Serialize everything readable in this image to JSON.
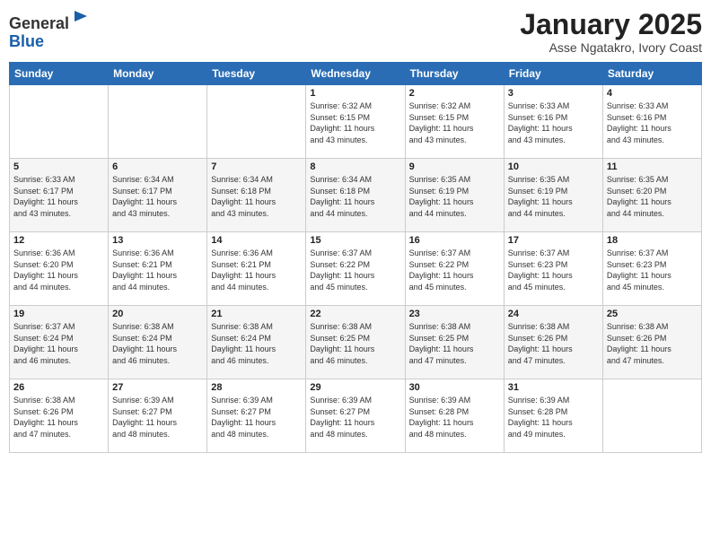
{
  "header": {
    "logo_general": "General",
    "logo_blue": "Blue",
    "month": "January 2025",
    "location": "Asse Ngatakro, Ivory Coast"
  },
  "weekdays": [
    "Sunday",
    "Monday",
    "Tuesday",
    "Wednesday",
    "Thursday",
    "Friday",
    "Saturday"
  ],
  "weeks": [
    [
      {
        "day": "",
        "info": ""
      },
      {
        "day": "",
        "info": ""
      },
      {
        "day": "",
        "info": ""
      },
      {
        "day": "1",
        "info": "Sunrise: 6:32 AM\nSunset: 6:15 PM\nDaylight: 11 hours\nand 43 minutes."
      },
      {
        "day": "2",
        "info": "Sunrise: 6:32 AM\nSunset: 6:15 PM\nDaylight: 11 hours\nand 43 minutes."
      },
      {
        "day": "3",
        "info": "Sunrise: 6:33 AM\nSunset: 6:16 PM\nDaylight: 11 hours\nand 43 minutes."
      },
      {
        "day": "4",
        "info": "Sunrise: 6:33 AM\nSunset: 6:16 PM\nDaylight: 11 hours\nand 43 minutes."
      }
    ],
    [
      {
        "day": "5",
        "info": "Sunrise: 6:33 AM\nSunset: 6:17 PM\nDaylight: 11 hours\nand 43 minutes."
      },
      {
        "day": "6",
        "info": "Sunrise: 6:34 AM\nSunset: 6:17 PM\nDaylight: 11 hours\nand 43 minutes."
      },
      {
        "day": "7",
        "info": "Sunrise: 6:34 AM\nSunset: 6:18 PM\nDaylight: 11 hours\nand 43 minutes."
      },
      {
        "day": "8",
        "info": "Sunrise: 6:34 AM\nSunset: 6:18 PM\nDaylight: 11 hours\nand 44 minutes."
      },
      {
        "day": "9",
        "info": "Sunrise: 6:35 AM\nSunset: 6:19 PM\nDaylight: 11 hours\nand 44 minutes."
      },
      {
        "day": "10",
        "info": "Sunrise: 6:35 AM\nSunset: 6:19 PM\nDaylight: 11 hours\nand 44 minutes."
      },
      {
        "day": "11",
        "info": "Sunrise: 6:35 AM\nSunset: 6:20 PM\nDaylight: 11 hours\nand 44 minutes."
      }
    ],
    [
      {
        "day": "12",
        "info": "Sunrise: 6:36 AM\nSunset: 6:20 PM\nDaylight: 11 hours\nand 44 minutes."
      },
      {
        "day": "13",
        "info": "Sunrise: 6:36 AM\nSunset: 6:21 PM\nDaylight: 11 hours\nand 44 minutes."
      },
      {
        "day": "14",
        "info": "Sunrise: 6:36 AM\nSunset: 6:21 PM\nDaylight: 11 hours\nand 44 minutes."
      },
      {
        "day": "15",
        "info": "Sunrise: 6:37 AM\nSunset: 6:22 PM\nDaylight: 11 hours\nand 45 minutes."
      },
      {
        "day": "16",
        "info": "Sunrise: 6:37 AM\nSunset: 6:22 PM\nDaylight: 11 hours\nand 45 minutes."
      },
      {
        "day": "17",
        "info": "Sunrise: 6:37 AM\nSunset: 6:23 PM\nDaylight: 11 hours\nand 45 minutes."
      },
      {
        "day": "18",
        "info": "Sunrise: 6:37 AM\nSunset: 6:23 PM\nDaylight: 11 hours\nand 45 minutes."
      }
    ],
    [
      {
        "day": "19",
        "info": "Sunrise: 6:37 AM\nSunset: 6:24 PM\nDaylight: 11 hours\nand 46 minutes."
      },
      {
        "day": "20",
        "info": "Sunrise: 6:38 AM\nSunset: 6:24 PM\nDaylight: 11 hours\nand 46 minutes."
      },
      {
        "day": "21",
        "info": "Sunrise: 6:38 AM\nSunset: 6:24 PM\nDaylight: 11 hours\nand 46 minutes."
      },
      {
        "day": "22",
        "info": "Sunrise: 6:38 AM\nSunset: 6:25 PM\nDaylight: 11 hours\nand 46 minutes."
      },
      {
        "day": "23",
        "info": "Sunrise: 6:38 AM\nSunset: 6:25 PM\nDaylight: 11 hours\nand 47 minutes."
      },
      {
        "day": "24",
        "info": "Sunrise: 6:38 AM\nSunset: 6:26 PM\nDaylight: 11 hours\nand 47 minutes."
      },
      {
        "day": "25",
        "info": "Sunrise: 6:38 AM\nSunset: 6:26 PM\nDaylight: 11 hours\nand 47 minutes."
      }
    ],
    [
      {
        "day": "26",
        "info": "Sunrise: 6:38 AM\nSunset: 6:26 PM\nDaylight: 11 hours\nand 47 minutes."
      },
      {
        "day": "27",
        "info": "Sunrise: 6:39 AM\nSunset: 6:27 PM\nDaylight: 11 hours\nand 48 minutes."
      },
      {
        "day": "28",
        "info": "Sunrise: 6:39 AM\nSunset: 6:27 PM\nDaylight: 11 hours\nand 48 minutes."
      },
      {
        "day": "29",
        "info": "Sunrise: 6:39 AM\nSunset: 6:27 PM\nDaylight: 11 hours\nand 48 minutes."
      },
      {
        "day": "30",
        "info": "Sunrise: 6:39 AM\nSunset: 6:28 PM\nDaylight: 11 hours\nand 48 minutes."
      },
      {
        "day": "31",
        "info": "Sunrise: 6:39 AM\nSunset: 6:28 PM\nDaylight: 11 hours\nand 49 minutes."
      },
      {
        "day": "",
        "info": ""
      }
    ]
  ]
}
